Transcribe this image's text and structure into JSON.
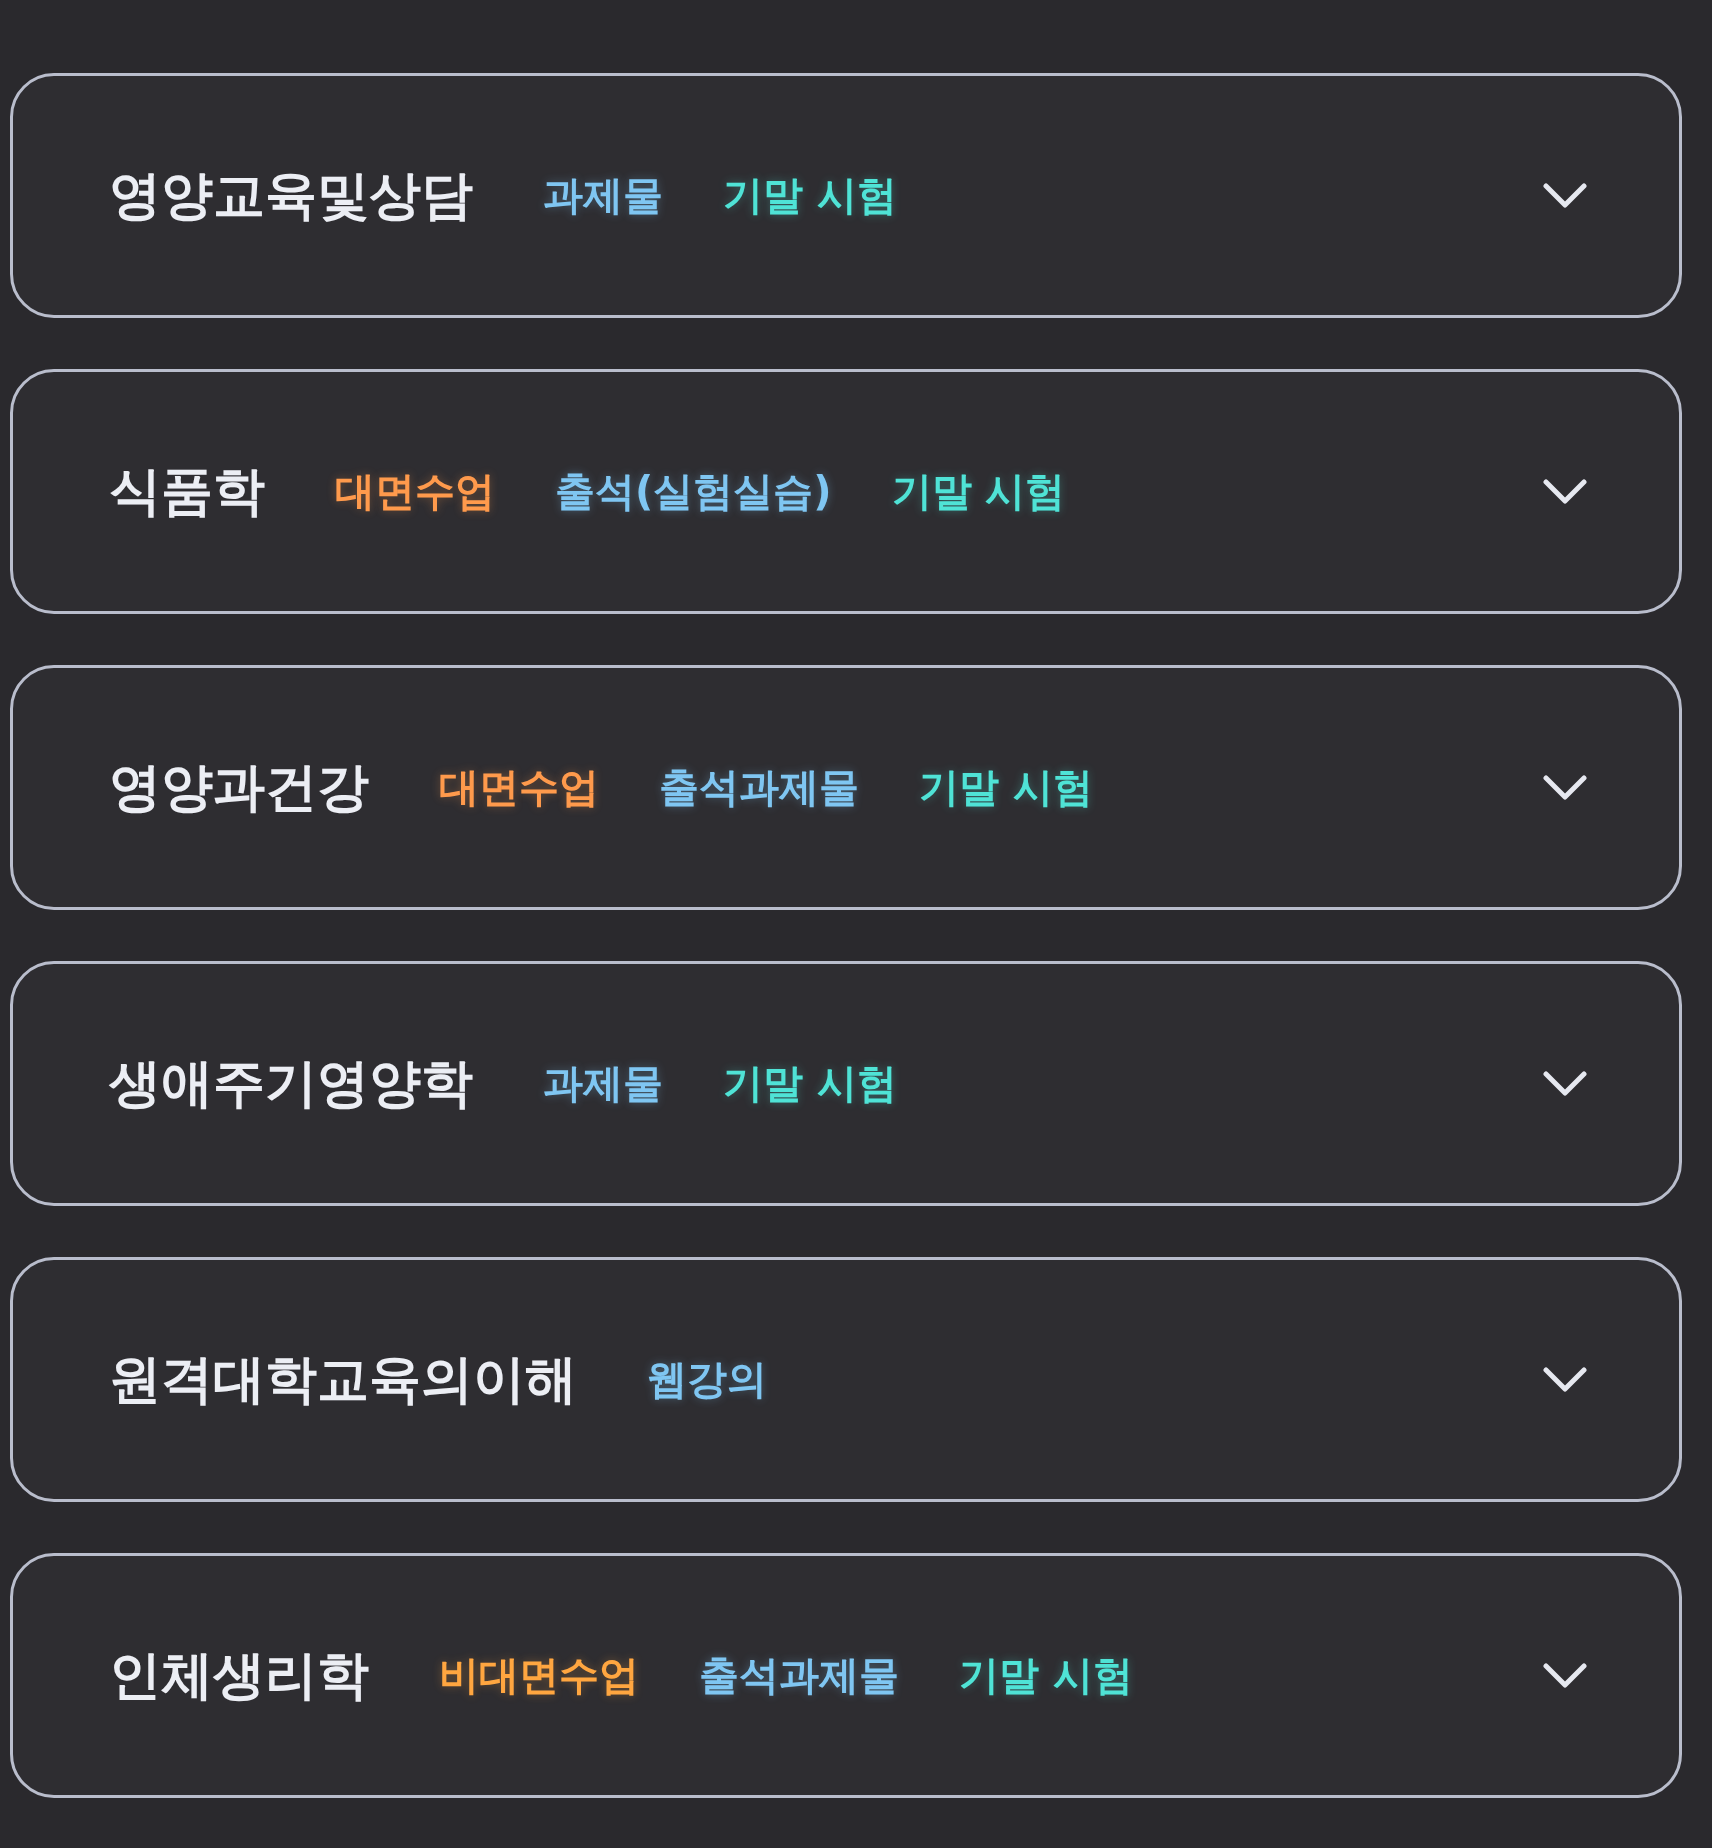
{
  "courses": [
    {
      "title": "영양교육및상담",
      "expanded": false,
      "tags": [
        {
          "label": "과제물",
          "color": "#7fc6f2"
        },
        {
          "label": "기말 시험",
          "color": "#4fe3d6"
        }
      ]
    },
    {
      "title": "식품학",
      "expanded": false,
      "tags": [
        {
          "label": "대면수업",
          "color": "#ff9a4c"
        },
        {
          "label": "출석(실험실습)",
          "color": "#7fc6f2"
        },
        {
          "label": "기말 시험",
          "color": "#4fe3d6"
        }
      ]
    },
    {
      "title": "영양과건강",
      "expanded": false,
      "tags": [
        {
          "label": "대면수업",
          "color": "#ff9a4c"
        },
        {
          "label": "출석과제물",
          "color": "#7fc6f2"
        },
        {
          "label": "기말 시험",
          "color": "#4fe3d6"
        }
      ]
    },
    {
      "title": "생애주기영양학",
      "expanded": false,
      "tags": [
        {
          "label": "과제물",
          "color": "#7fc6f2"
        },
        {
          "label": "기말 시험",
          "color": "#4fe3d6"
        }
      ]
    },
    {
      "title": "원격대학교육의이해",
      "expanded": false,
      "tags": [
        {
          "label": "웹강의",
          "color": "#7fc6f2"
        }
      ]
    },
    {
      "title": "인체생리학",
      "expanded": false,
      "tags": [
        {
          "label": "비대면수업",
          "color": "#ffa640"
        },
        {
          "label": "출석과제물",
          "color": "#7fc6f2"
        },
        {
          "label": "기말 시험",
          "color": "#4fe3d6"
        }
      ]
    }
  ]
}
